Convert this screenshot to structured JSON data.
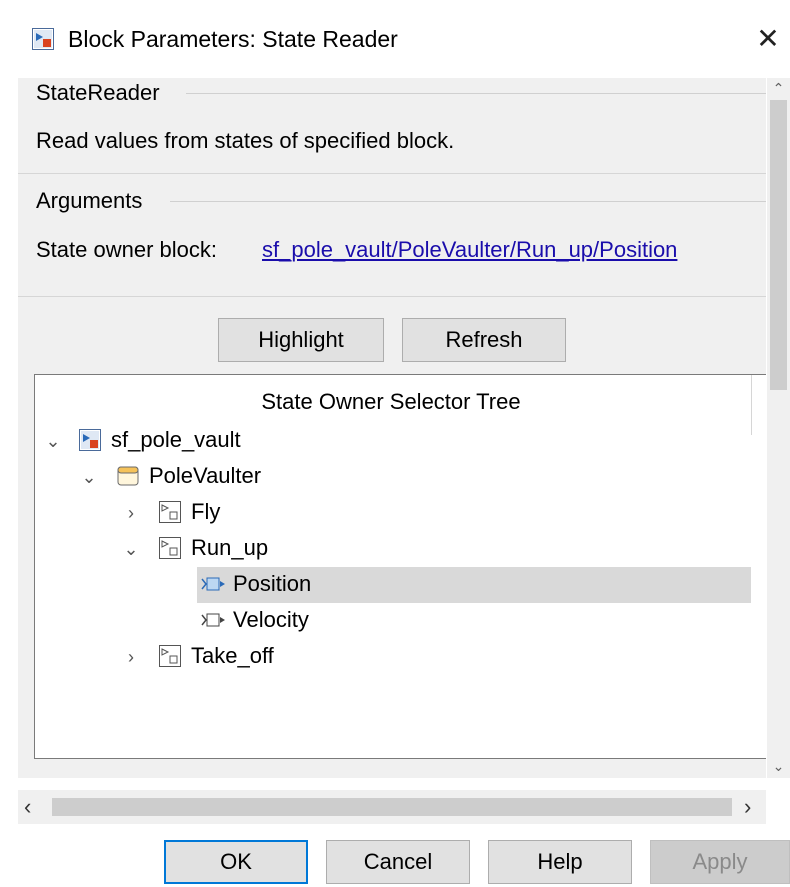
{
  "dialog": {
    "title": "Block Parameters: State Reader"
  },
  "state_reader": {
    "group_label": "StateReader",
    "description": "Read values from states of specified block."
  },
  "arguments": {
    "group_label": "Arguments",
    "owner_label": "State owner block:",
    "owner_link": "sf_pole_vault/PoleVaulter/Run_up/Position"
  },
  "actions": {
    "highlight_label": "Highlight",
    "refresh_label": "Refresh"
  },
  "tree": {
    "header": "State Owner Selector Tree",
    "nodes": [
      {
        "label": "sf_pole_vault",
        "icon": "model-icon",
        "expanded": true,
        "level": 0
      },
      {
        "label": "PoleVaulter",
        "icon": "chart-icon",
        "expanded": true,
        "level": 1
      },
      {
        "label": "Fly",
        "icon": "subsystem-icon",
        "expanded": false,
        "level": 2
      },
      {
        "label": "Run_up",
        "icon": "subsystem-icon",
        "expanded": true,
        "level": 2
      },
      {
        "label": "Position",
        "icon": "state-icon",
        "level": 3,
        "selected": true
      },
      {
        "label": "Velocity",
        "icon": "state-icon",
        "level": 3,
        "selected": false
      },
      {
        "label": "Take_off",
        "icon": "subsystem-icon",
        "expanded": false,
        "level": 2
      }
    ]
  },
  "footer": {
    "ok_label": "OK",
    "cancel_label": "Cancel",
    "help_label": "Help",
    "apply_label": "Apply"
  },
  "colors": {
    "link": "#1a0dab",
    "selection": "#d9d9d9",
    "default_button_border": "#0078d7"
  }
}
